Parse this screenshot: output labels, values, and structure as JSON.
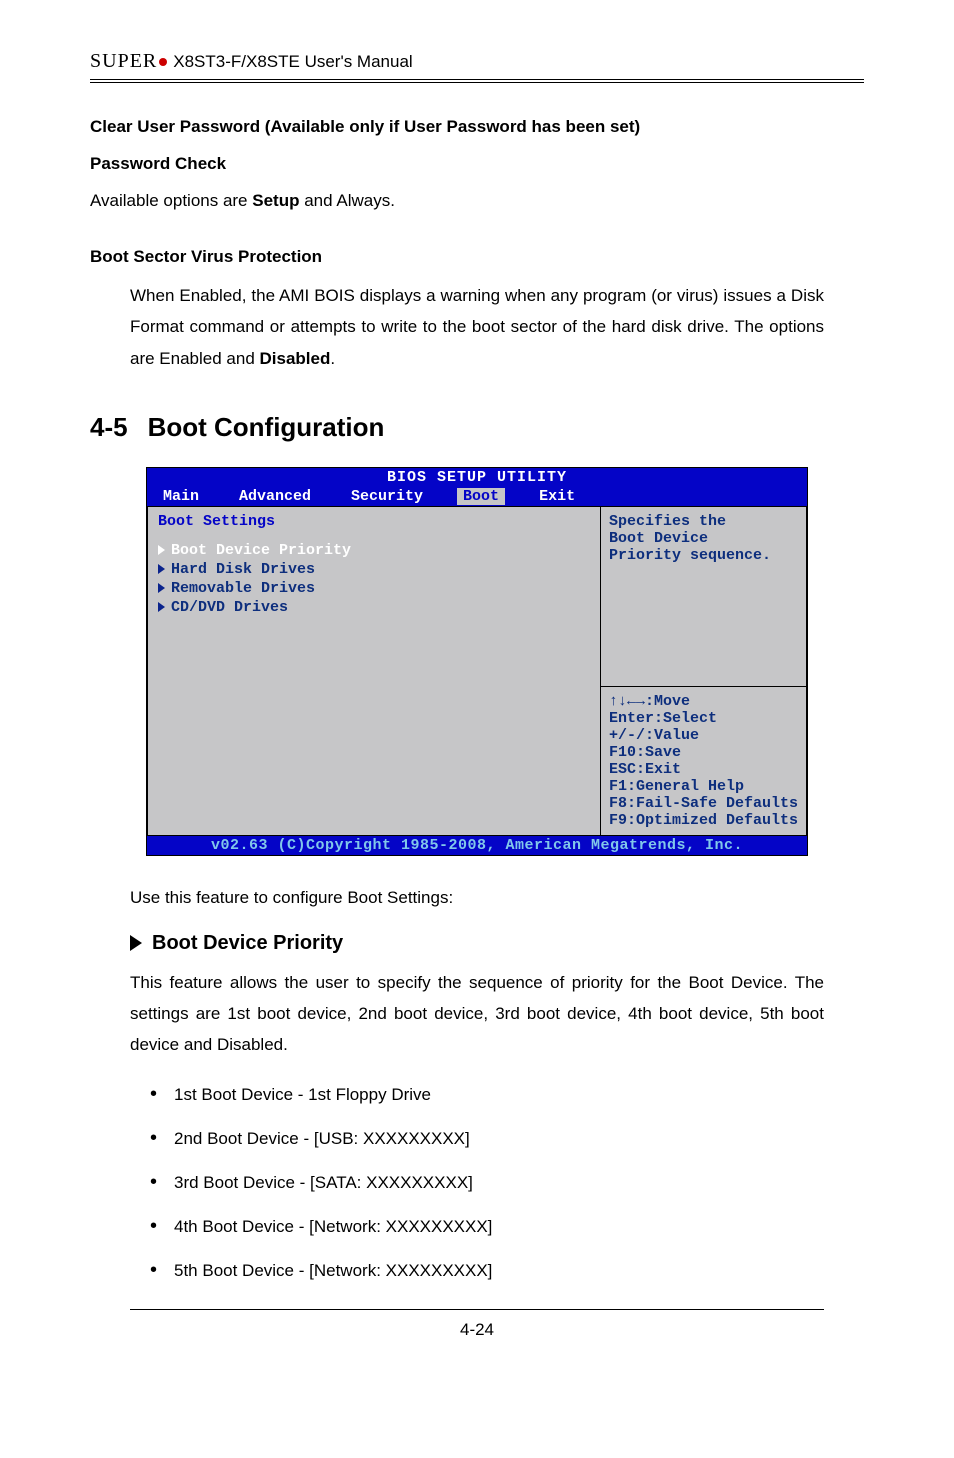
{
  "header": {
    "brand": "SUPER",
    "title": "X8ST3-F/X8STE User's Manual"
  },
  "top_block": {
    "l1": "Clear User Password (Available only if User Password has been set)",
    "l2": "Password Check",
    "l3_p1": "Available options are ",
    "l3_b": "Setup",
    "l3_p2": " and Always."
  },
  "bsvp": {
    "title": "Boot Sector Virus Protection",
    "p_pre": "When Enabled, the AMI BOIS displays a warning when any program (or virus) issues a Disk Format command or attempts to write to the boot sector of the hard disk drive. The options are Enabled and ",
    "p_bold": "Disabled",
    "p_post": "."
  },
  "section": {
    "num": "4-5",
    "title": "Boot Configuration"
  },
  "bios": {
    "title": "BIOS SETUP UTILITY",
    "tabs": [
      "Main",
      "Advanced",
      "Security",
      "Boot",
      "Exit"
    ],
    "active_tab": "Boot",
    "boot_settings": "Boot Settings",
    "items": [
      "Boot Device Priority",
      "Hard Disk Drives",
      "Removable Drives",
      "CD/DVD Drives"
    ],
    "help1": "Specifies the",
    "help2": "Boot Device",
    "help3": "Priority sequence.",
    "keys": [
      "↑↓←→:Move",
      "Enter:Select",
      "+/-/:Value",
      "F10:Save",
      "ESC:Exit",
      "F1:General Help",
      "F8:Fail-Safe Defaults",
      "F9:Optimized Defaults"
    ],
    "footer": "v02.63 (C)Copyright 1985-2008, American Megatrends, Inc."
  },
  "after_bios": "Use this feature to configure Boot Settings:",
  "bdp": {
    "title": "Boot Device Priority",
    "para": "This feature allows the user to specify the sequence of priority for the Boot Device. The settings are 1st boot device, 2nd boot device, 3rd boot device, 4th boot device, 5th boot device and Disabled."
  },
  "boot_list": [
    "1st Boot Device - 1st Floppy Drive",
    "2nd Boot Device - [USB: XXXXXXXXX]",
    "3rd Boot Device - [SATA: XXXXXXXXX]",
    "4th Boot Device - [Network: XXXXXXXXX]",
    "5th Boot Device - [Network: XXXXXXXXX]"
  ],
  "footer": "4-24"
}
